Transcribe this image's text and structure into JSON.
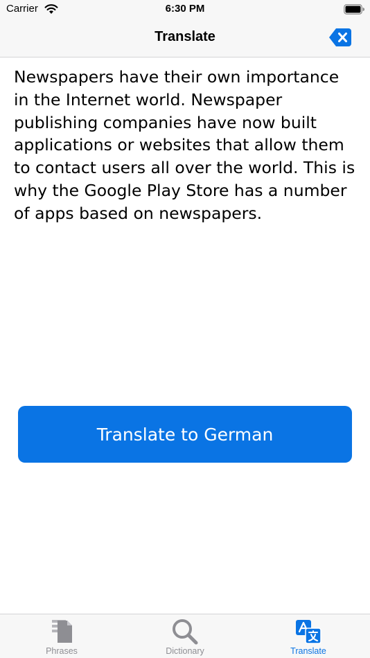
{
  "status_bar": {
    "carrier": "Carrier",
    "time": "6:30 PM"
  },
  "nav": {
    "title": "Translate",
    "clear_icon": "delete-backward-icon"
  },
  "content": {
    "source_text": "Newspapers have their own importance in the Internet world. Newspaper publishing companies have now built applications or websites that allow them to contact users all over the world. This is why the Google Play Store has a number of apps based on newspapers."
  },
  "actions": {
    "translate_label": "Translate to German"
  },
  "tab_bar": {
    "active": "Translate",
    "tabs": [
      {
        "label": "Phrases",
        "icon": "document-stack-icon"
      },
      {
        "label": "Dictionary",
        "icon": "magnifier-icon"
      },
      {
        "label": "Translate",
        "icon": "translate-icon"
      }
    ]
  },
  "colors": {
    "accent": "#0a74e4",
    "inactive": "#8e8e93",
    "bar_background": "#f7f7f7"
  }
}
